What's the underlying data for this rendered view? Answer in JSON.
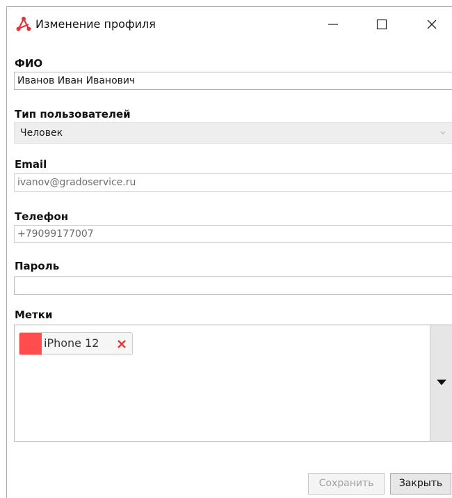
{
  "window": {
    "title": "Изменение профиля",
    "controls": {
      "minimize": "minimize-icon",
      "maximize": "maximize-icon",
      "close": "close-icon"
    }
  },
  "form": {
    "fio": {
      "label": "ФИО",
      "value": "Иванов Иван Иванович"
    },
    "user_type": {
      "label": "Тип пользователей",
      "value": "Человек"
    },
    "email": {
      "label": "Email",
      "value": "ivanov@gradoservice.ru"
    },
    "phone": {
      "label": "Телефон",
      "value": "+79099177007"
    },
    "password": {
      "label": "Пароль",
      "value": ""
    },
    "tags": {
      "label": "Метки",
      "items": [
        {
          "text": "iPhone 12",
          "color": "#ff4d4d"
        }
      ]
    }
  },
  "buttons": {
    "save": "Сохранить",
    "close": "Закрыть"
  },
  "colors": {
    "accent": "#e5333a",
    "tag_color": "#ff4d4d",
    "remove_icon": "#e53935"
  }
}
